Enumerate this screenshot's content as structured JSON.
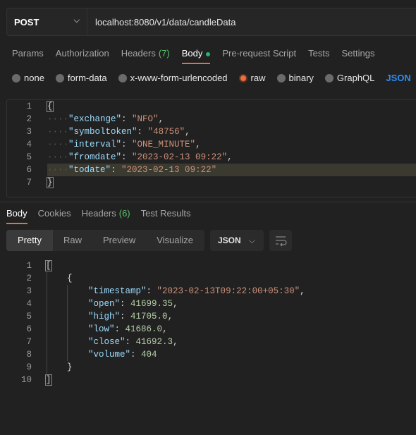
{
  "request": {
    "method": "POST",
    "url": "localhost:8080/v1/data/candleData"
  },
  "request_tabs": [
    {
      "label": "Params"
    },
    {
      "label": "Authorization"
    },
    {
      "label": "Headers",
      "count": "(7)"
    },
    {
      "label": "Body",
      "active": true,
      "dot": true
    },
    {
      "label": "Pre-request Script"
    },
    {
      "label": "Tests"
    },
    {
      "label": "Settings"
    }
  ],
  "body_types": [
    {
      "label": "none"
    },
    {
      "label": "form-data"
    },
    {
      "label": "x-www-form-urlencoded"
    },
    {
      "label": "raw",
      "selected": true
    },
    {
      "label": "binary"
    },
    {
      "label": "GraphQL"
    }
  ],
  "body_format": "JSON",
  "request_body": [
    [
      [
        "br",
        "{"
      ]
    ],
    [
      [
        "w",
        "····"
      ],
      [
        "k",
        "\"exchange\""
      ],
      [
        "p",
        ": "
      ],
      [
        "s",
        "\"NFO\""
      ],
      [
        "p",
        ","
      ]
    ],
    [
      [
        "w",
        "····"
      ],
      [
        "k",
        "\"symboltoken\""
      ],
      [
        "p",
        ": "
      ],
      [
        "s",
        "\"48756\""
      ],
      [
        "p",
        ","
      ]
    ],
    [
      [
        "w",
        "····"
      ],
      [
        "k",
        "\"interval\""
      ],
      [
        "p",
        ": "
      ],
      [
        "s",
        "\"ONE_MINUTE\""
      ],
      [
        "p",
        ","
      ]
    ],
    [
      [
        "w",
        "····"
      ],
      [
        "k",
        "\"fromdate\""
      ],
      [
        "p",
        ": "
      ],
      [
        "s",
        "\"2023-02-13 09:22\""
      ],
      [
        "p",
        ","
      ]
    ],
    [
      [
        "w",
        "····"
      ],
      [
        "k",
        "\"todate\""
      ],
      [
        "p",
        ": "
      ],
      [
        "s",
        "\"2023-02-13 09:22\""
      ]
    ],
    [
      [
        "br",
        "}"
      ]
    ]
  ],
  "highlighted_line": 6,
  "response_tabs": [
    {
      "label": "Body",
      "active": true
    },
    {
      "label": "Cookies"
    },
    {
      "label": "Headers",
      "count": "(6)"
    },
    {
      "label": "Test Results"
    }
  ],
  "view_modes": [
    {
      "label": "Pretty",
      "active": true
    },
    {
      "label": "Raw"
    },
    {
      "label": "Preview"
    },
    {
      "label": "Visualize"
    }
  ],
  "response_format": "JSON",
  "response_body": [
    [
      [
        "br",
        "["
      ]
    ],
    [
      [
        "p",
        "    {"
      ]
    ],
    [
      [
        "p",
        "        "
      ],
      [
        "k",
        "\"timestamp\""
      ],
      [
        "p",
        ": "
      ],
      [
        "s",
        "\"2023-02-13T09:22:00+05:30\""
      ],
      [
        "p",
        ","
      ]
    ],
    [
      [
        "p",
        "        "
      ],
      [
        "k",
        "\"open\""
      ],
      [
        "p",
        ": "
      ],
      [
        "n",
        "41699.35"
      ],
      [
        "p",
        ","
      ]
    ],
    [
      [
        "p",
        "        "
      ],
      [
        "k",
        "\"high\""
      ],
      [
        "p",
        ": "
      ],
      [
        "n",
        "41705.0"
      ],
      [
        "p",
        ","
      ]
    ],
    [
      [
        "p",
        "        "
      ],
      [
        "k",
        "\"low\""
      ],
      [
        "p",
        ": "
      ],
      [
        "n",
        "41686.0"
      ],
      [
        "p",
        ","
      ]
    ],
    [
      [
        "p",
        "        "
      ],
      [
        "k",
        "\"close\""
      ],
      [
        "p",
        ": "
      ],
      [
        "n",
        "41692.3"
      ],
      [
        "p",
        ","
      ]
    ],
    [
      [
        "p",
        "        "
      ],
      [
        "k",
        "\"volume\""
      ],
      [
        "p",
        ": "
      ],
      [
        "n",
        "404"
      ]
    ],
    [
      [
        "p",
        "    }"
      ]
    ],
    [
      [
        "br",
        "]"
      ]
    ]
  ],
  "colors": {
    "accent": "#f26b3a",
    "key": "#9cdcfe",
    "string": "#ce9178",
    "number": "#b5cea8",
    "count": "#5cc26b",
    "link": "#2f8cf5"
  }
}
